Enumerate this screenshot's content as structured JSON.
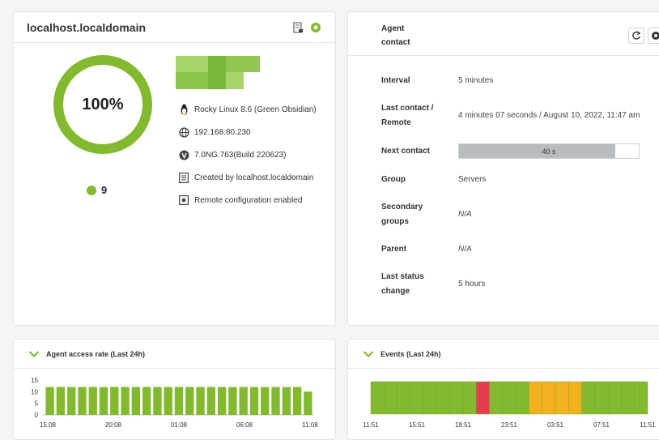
{
  "host_card": {
    "title": "localhost.localdomain",
    "percent": "100%",
    "module_count": "9",
    "os": "Rocky Linux 8.6 (Green Obsidian)",
    "ip": "192.168.80.230",
    "version": "7.0NG.763(Build 220623)",
    "created_by": "Created by localhost.localdomain",
    "remote_config": "Remote configuration enabled"
  },
  "agent_card": {
    "title": "Agent contact",
    "rows": [
      {
        "label": "Interval",
        "value": "5 minutes"
      },
      {
        "label": "Last contact / Remote",
        "value": "4 minutes 07 seconds / August 10, 2022, 11:47 am"
      },
      {
        "label": "Next contact",
        "value": "40 s"
      },
      {
        "label": "Group",
        "value": "Servers"
      },
      {
        "label": "Secondary groups",
        "value": "N/A"
      },
      {
        "label": "Parent",
        "value": "N/A"
      },
      {
        "label": "Last status change",
        "value": "5 hours"
      }
    ],
    "next_contact_progress": 0.87
  },
  "access_card": {
    "title": "Agent access rate (Last 24h)"
  },
  "events_card": {
    "title": "Events (Last 24h)"
  },
  "chart_data": [
    {
      "type": "bar",
      "title": "Agent access rate (Last 24h)",
      "yticks": [
        "15",
        "10",
        "5",
        "0"
      ],
      "ylim": [
        0,
        15
      ],
      "xticks": [
        "15:08",
        "20:08",
        "01:08",
        "06:08",
        "11:08"
      ],
      "values": [
        12,
        12,
        12,
        12,
        12,
        12,
        12,
        12,
        12,
        12,
        12,
        12,
        12,
        12,
        12,
        12,
        12,
        12,
        12,
        12,
        12,
        12,
        12,
        12,
        10
      ],
      "color": "#82b92e"
    },
    {
      "type": "heatmap",
      "title": "Events (Last 24h)",
      "xticks": [
        "11:51",
        "15:51",
        "19:51",
        "23:51",
        "03:51",
        "07:51",
        "11:51"
      ],
      "segments": [
        "green",
        "green",
        "green",
        "green",
        "green",
        "green",
        "green",
        "green",
        "red",
        "green",
        "green",
        "green",
        "orange",
        "orange",
        "orange",
        "orange",
        "green",
        "green",
        "green",
        "green",
        "green"
      ],
      "colors": {
        "green": "#82b92e",
        "red": "#e63c52",
        "orange": "#f2b11e"
      }
    }
  ]
}
